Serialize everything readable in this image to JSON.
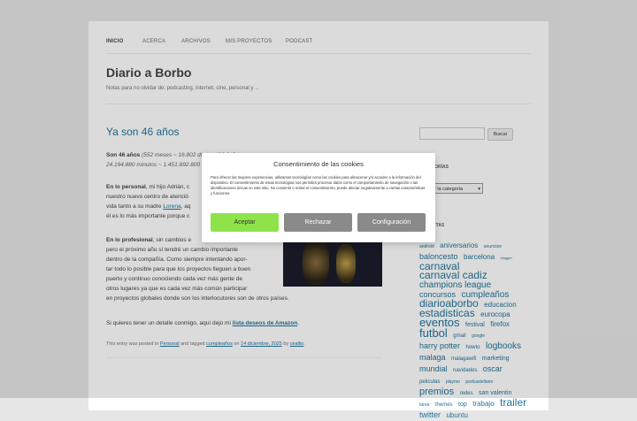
{
  "nav": {
    "items": [
      "INICIO",
      "ACERCA",
      "ARCHIVOS",
      "MIS PROYECTOS",
      "PODCAST"
    ]
  },
  "site": {
    "title": "Diario a Borbo",
    "tagline": "Notas para no olvidar de: podcasting, internet, cine, personal y ..."
  },
  "post": {
    "title": "Ya son 46 años",
    "stats_label": "Son 46 años",
    "stats_text": "(552 meses ~ 16.802 días ~ 403.248 h",
    "stats_text2": "24.194.880 minutos ~ 1.451.692.800",
    "personal_label": "En lo personal",
    "personal_text": ", mi hijo Adrián, c",
    "personal_line2": "nuestro nuevo centro de atenció",
    "personal_line3a": "vida tanto a su madre ",
    "personal_link": "Lorena",
    "personal_line3b": ", aq",
    "personal_line4": "él es lo más importante porque c",
    "prof_label": "En lo profesional",
    "prof_text": ", sin cambios e",
    "prof_lines": [
      "pero el próximo año sí tendré un cambio importante",
      "dentro de la compañía. Como siempre intentando apor-",
      "tar todo lo posible para que los proyectos lleguen a buen",
      "puerto y continuo conociendo cada vez más gente de",
      "otros lugares ya que es cada vez más común participar",
      "en proyectos globales donde son los interlocutores son de otros países."
    ],
    "gift_text": "Si quieres tener un detalle conmigo, aquí dejo mi ",
    "gift_link": "lista deseos de Amazon",
    "meta_prefix": "This entry was posted in ",
    "meta_category": "Personal",
    "meta_tagged": " and tagged ",
    "meta_tag": "cumpleaños",
    "meta_on": " on ",
    "meta_date": "14 diciembre, 2025",
    "meta_by": " by ",
    "meta_author": "ceallio",
    "meta_end": "."
  },
  "sidebar": {
    "search_button": "Buscar",
    "categories_heading": "CATEGORÍAS",
    "categories_select": "r la categoría",
    "tags_heading": "ETIQUETAS",
    "tags": [
      {
        "t": "android",
        "s": 5
      },
      {
        "t": "aniversarios",
        "s": 8
      },
      {
        "t": "anuncios",
        "s": 5
      },
      {
        "t": "baloncesto",
        "s": 9
      },
      {
        "t": "barcelona",
        "s": 8
      },
      {
        "t": "blogger",
        "s": 4
      },
      {
        "t": "carnaval",
        "s": 12
      },
      {
        "t": "carnaval cadiz",
        "s": 12
      },
      {
        "t": "champions league",
        "s": 10
      },
      {
        "t": "concursos",
        "s": 9
      },
      {
        "t": "cumpleaños",
        "s": 10
      },
      {
        "t": "diarioaborbo",
        "s": 12
      },
      {
        "t": "educacion",
        "s": 8
      },
      {
        "t": "estadisticas",
        "s": 12
      },
      {
        "t": "eurocopa",
        "s": 8
      },
      {
        "t": "eventos",
        "s": 13
      },
      {
        "t": "festival",
        "s": 7
      },
      {
        "t": "firefox",
        "s": 8
      },
      {
        "t": "futbol",
        "s": 13
      },
      {
        "t": "gmail",
        "s": 6
      },
      {
        "t": "google",
        "s": 5
      },
      {
        "t": "harry potter",
        "s": 9
      },
      {
        "t": "howto",
        "s": 6
      },
      {
        "t": "logbooks",
        "s": 10
      },
      {
        "t": "malaga",
        "s": 9
      },
      {
        "t": "malagawifi",
        "s": 6
      },
      {
        "t": "marketing",
        "s": 7
      },
      {
        "t": "mundial",
        "s": 9
      },
      {
        "t": "navidades",
        "s": 6
      },
      {
        "t": "oscar",
        "s": 9
      },
      {
        "t": "peliculas",
        "s": 6
      },
      {
        "t": "playmo",
        "s": 5
      },
      {
        "t": "podcastellano",
        "s": 5
      },
      {
        "t": "premios",
        "s": 11
      },
      {
        "t": "redes",
        "s": 6
      },
      {
        "t": "san valentin",
        "s": 7
      },
      {
        "t": "tarea",
        "s": 5
      },
      {
        "t": "themes",
        "s": 6
      },
      {
        "t": "top",
        "s": 7
      },
      {
        "t": "trabajo",
        "s": 8
      },
      {
        "t": "trailer",
        "s": 12
      },
      {
        "t": "twitter",
        "s": 9
      },
      {
        "t": "ubuntu",
        "s": 8
      }
    ]
  },
  "cookie": {
    "title": "Consentimiento de las cookies",
    "body": "Para ofrecer las mejores experiencias, utilizamos tecnologías como las cookies para almacenar y/o acceder a la información del dispositivo. El consentimiento de estas tecnologías nos permitirá procesar datos como el comportamiento de navegación o las identificaciones únicas en este sitio. No consentir o retirar el consentimiento, puede afectar negativamente a ciertas características y funciones.",
    "accept": "Aceptar",
    "reject": "Rechazar",
    "config": "Configuración"
  },
  "colors": {
    "accent": "#21759b",
    "accept": "#8ee34b",
    "secondary": "#8a8a8a"
  }
}
